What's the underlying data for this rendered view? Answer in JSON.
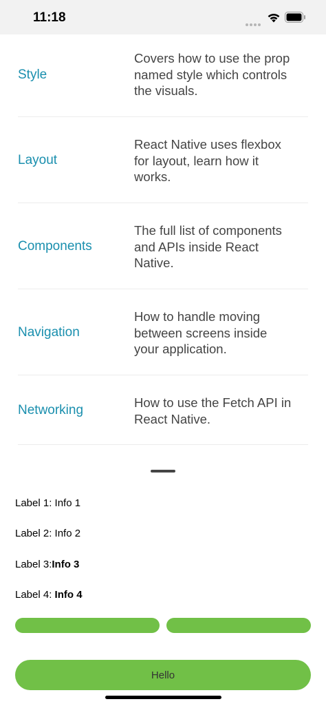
{
  "status_bar": {
    "time": "11:18"
  },
  "topics": [
    {
      "title": "Style",
      "lines": [
        "Covers how to use the prop",
        "named style which controls",
        "the visuals."
      ]
    },
    {
      "title": "Layout",
      "lines": [
        "React Native uses flexbox",
        "for layout, learn how it",
        "works."
      ]
    },
    {
      "title": "Components",
      "lines": [
        "The full list of components",
        "and APIs inside React",
        "Native."
      ]
    },
    {
      "title": "Navigation",
      "lines": [
        "How to handle moving",
        "between screens inside",
        "your application."
      ]
    },
    {
      "title": "Networking",
      "lines": [
        "How to use the Fetch API in",
        "React Native."
      ]
    }
  ],
  "info_rows": [
    {
      "label": "Label 1: ",
      "value": "Info 1",
      "value_bold": false
    },
    {
      "label": "Label 2: ",
      "value": "Info 2",
      "value_bold": false
    },
    {
      "label": "Label 3:",
      "value": "Info 3",
      "value_bold": true
    },
    {
      "label": "Label 4: ",
      "value": "Info 4",
      "value_bold": true
    }
  ],
  "buttons": {
    "large_label": "Hello"
  },
  "colors": {
    "link": "#1a8fae",
    "button": "#71c047"
  }
}
